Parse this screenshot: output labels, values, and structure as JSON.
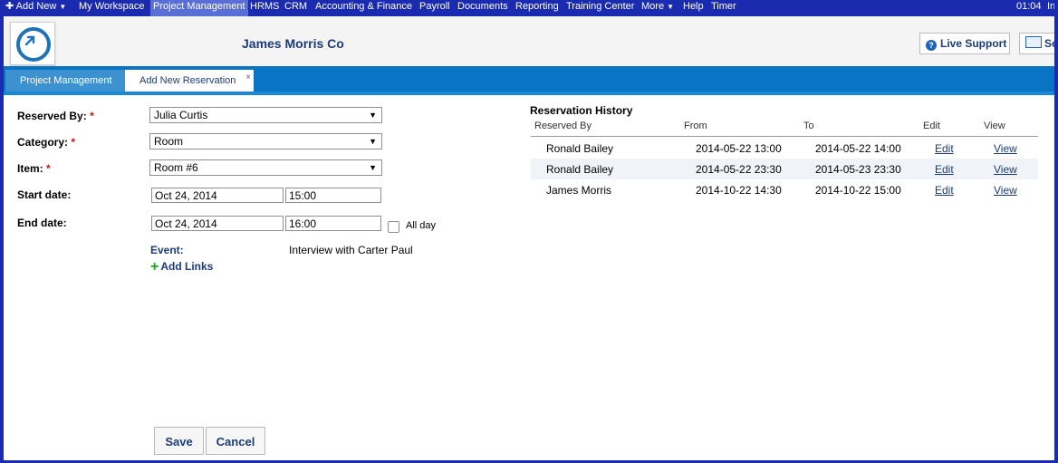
{
  "topbar": {
    "items": [
      {
        "label": "Add New",
        "caret": true
      },
      {
        "label": "My Workspace"
      },
      {
        "label": "Project Management",
        "active": true
      },
      {
        "label": "HRMS"
      },
      {
        "label": "CRM"
      },
      {
        "label": "Accounting & Finance"
      },
      {
        "label": "Payroll"
      },
      {
        "label": "Documents"
      },
      {
        "label": "Reporting"
      },
      {
        "label": "Training Center"
      },
      {
        "label": "More",
        "caret": true
      },
      {
        "label": "Help"
      },
      {
        "label": "Timer"
      }
    ],
    "time": "01:04",
    "time_suffix": "In"
  },
  "header": {
    "company": "James Morris Co",
    "live_support": "Live Support",
    "send": "Se"
  },
  "tabs": [
    {
      "label": "Project Management",
      "active": false
    },
    {
      "label": "Add New Reservation",
      "active": true,
      "close": "×"
    }
  ],
  "form": {
    "reserved_by": {
      "label": "Reserved By:",
      "required": "*",
      "value": "Julia Curtis"
    },
    "category": {
      "label": "Category:",
      "required": "*",
      "value": "Room"
    },
    "item": {
      "label": "Item:",
      "required": "*",
      "value": "Room #6"
    },
    "start_date": {
      "label": "Start date:",
      "date": "Oct 24, 2014",
      "time": "15:00"
    },
    "end_date": {
      "label": "End date:",
      "date": "Oct 24, 2014",
      "time": "16:00"
    },
    "all_day": "All day",
    "event_label": "Event:",
    "event_value": "Interview with Carter Paul",
    "add_links": "Add Links",
    "arrow": "▼"
  },
  "history": {
    "title": "Reservation History",
    "columns": [
      "Reserved By",
      "From",
      "To",
      "Edit",
      "View"
    ],
    "rows": [
      {
        "reserved_by": "Ronald Bailey",
        "from": "2014-05-22 13:00",
        "to": "2014-05-22 14:00",
        "edit": "Edit",
        "view": "View"
      },
      {
        "reserved_by": "Ronald Bailey",
        "from": "2014-05-22 23:30",
        "to": "2014-05-23 23:30",
        "edit": "Edit",
        "view": "View"
      },
      {
        "reserved_by": "James Morris",
        "from": "2014-10-22 14:30",
        "to": "2014-10-22 15:00",
        "edit": "Edit",
        "view": "View"
      }
    ]
  },
  "buttons": {
    "save": "Save",
    "cancel": "Cancel"
  },
  "colors": {
    "topbar": "#1b2bb0",
    "tabbar": "#0a74c4",
    "accent_text": "#1b3c78",
    "required": "#d01010"
  }
}
